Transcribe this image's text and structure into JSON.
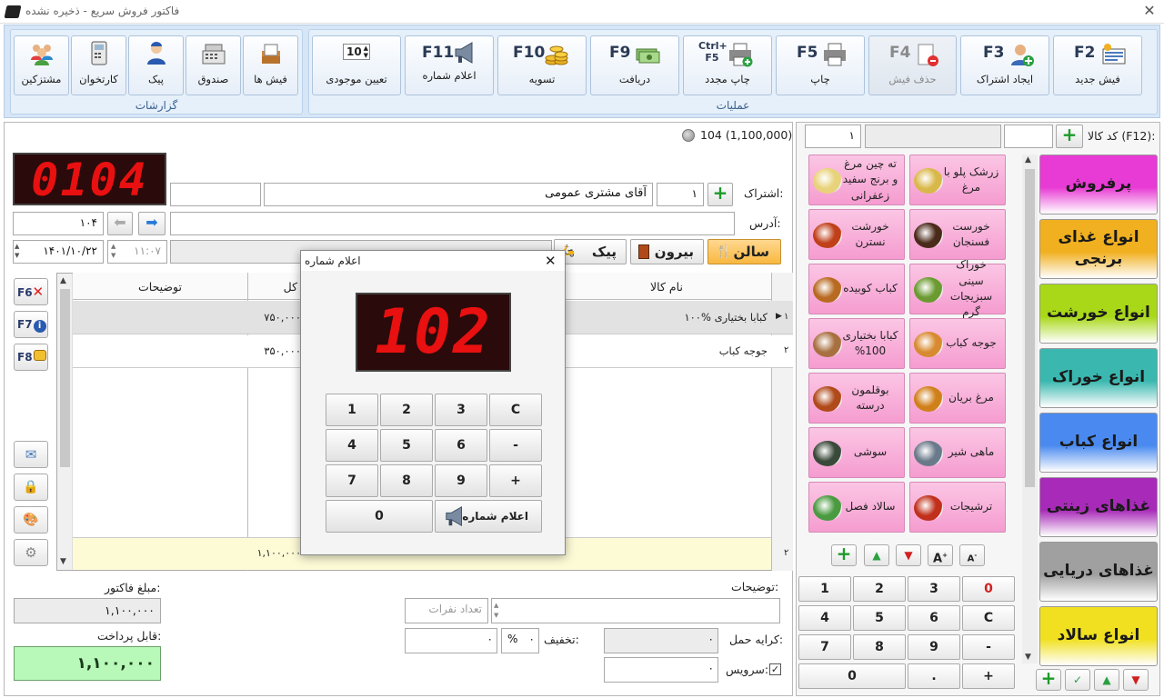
{
  "window": {
    "title": "فاکتور فروش سریع - ذخیره نشده"
  },
  "ribbon": {
    "groups": {
      "operations": "عملیات",
      "reports": "گزارشات"
    },
    "operations": [
      {
        "key": "F2",
        "label": "فیش جدید",
        "icon": "new-invoice-icon"
      },
      {
        "key": "F3",
        "label": "ایجاد اشتراک",
        "icon": "add-subscription-icon"
      },
      {
        "key": "F4",
        "label": "حذف فیش",
        "icon": "delete-invoice-icon",
        "disabled": true
      },
      {
        "key": "F5",
        "label": "چاپ",
        "icon": "printer-icon"
      },
      {
        "key": "Ctrl+ F5",
        "label": "چاپ مجدد",
        "icon": "reprint-icon"
      },
      {
        "key": "F9",
        "label": "دریافت",
        "icon": "cash-icon"
      },
      {
        "key": "F10",
        "label": "تسویه",
        "icon": "coins-icon"
      },
      {
        "key": "F11",
        "label": "اعلام شماره",
        "icon": "megaphone-icon"
      },
      {
        "key": "10",
        "label": "تعیین موجودی",
        "icon": "stepper-icon"
      }
    ],
    "reports": [
      {
        "label": "فیش ها",
        "icon": "receipts-icon"
      },
      {
        "label": "صندوق",
        "icon": "cash-register-icon"
      },
      {
        "label": "پیک",
        "icon": "courier-icon"
      },
      {
        "label": "کارتخوان",
        "icon": "card-reader-icon"
      },
      {
        "label": "مشتزکین",
        "icon": "customers-icon"
      }
    ]
  },
  "invoice": {
    "header_info": "104 (1,100,000)",
    "display_number": "0104",
    "subscription_label": "اشتراک:",
    "subscription_code": "۱",
    "customer_name": "آقای مشتری عمومی",
    "address_label": "آدرس:",
    "invoice_no": "۱۰۴",
    "time": "۱۱:۰۷",
    "date": "۱۴۰۱/۱۰/۲۲",
    "service_types": [
      "سالن",
      "بیرون",
      "پیک"
    ]
  },
  "grid": {
    "headers": {
      "row": "",
      "name": "نام کالا",
      "total": "مبلغ کل",
      "desc": "توضیحات"
    },
    "rows": [
      {
        "idx": "۱",
        "name": "کبابا بختیاری %۱۰۰",
        "total": "۷۵۰,۰۰۰"
      },
      {
        "idx": "۲",
        "name": "جوجه کباب",
        "total": "۳۵۰,۰۰۰"
      }
    ],
    "footer": {
      "idx": "۲",
      "total": "۱,۱۰۰,۰۰۰"
    }
  },
  "side_buttons": [
    "F6",
    "F7",
    "F8"
  ],
  "footer": {
    "desc_label": "توضیحات:",
    "people_placeholder": "تعداد نفرات",
    "shipping_label": "کرایه حمل:",
    "shipping_value": "۰",
    "discount_label": "تخفیف:",
    "discount_percent": "۰",
    "percent_sign": "%",
    "discount_value": "۰",
    "service_label": "سرویس:",
    "service_value": "۰",
    "amount_label": "مبلغ فاکتور:",
    "amount_value": "۱,۱۰۰,۰۰۰",
    "payable_label": "قابل پرداخت:",
    "payable_value": "۱,۱۰۰,۰۰۰"
  },
  "product_search": {
    "label": "کد کالا (F12):",
    "qty": "۱"
  },
  "foods": [
    {
      "label": "زرشک پلو با مرغ",
      "color": "#d9b84a"
    },
    {
      "label": "ته چین مرغ و برنج سفید زعفرانی",
      "color": "#e8d27a"
    },
    {
      "label": "خورست فسنجان",
      "color": "#4a2a1a"
    },
    {
      "label": "خورشت نسترن",
      "color": "#c0401a"
    },
    {
      "label": "خوراک سینی سبزیجات گرم",
      "color": "#6a9a30"
    },
    {
      "label": "کباب کوبیده",
      "color": "#b86a20"
    },
    {
      "label": "جوجه کباب",
      "color": "#d88a30"
    },
    {
      "label": "کبابا بختیاری 100%",
      "color": "#a87040"
    },
    {
      "label": "مرغ بریان",
      "color": "#d0801a"
    },
    {
      "label": "بوقلمون درسته",
      "color": "#b04a1a"
    },
    {
      "label": "ماهی شیر",
      "color": "#6a7a8a"
    },
    {
      "label": "سوشی",
      "color": "#3a4a3a"
    },
    {
      "label": "ترشیجات",
      "color": "#c0301a"
    },
    {
      "label": "سالاد فصل",
      "color": "#4a9a40"
    }
  ],
  "categories": [
    {
      "label": "پرفروش",
      "color": "#e83ad4"
    },
    {
      "label": "انواع غذای برنجی",
      "color": "#f0b020"
    },
    {
      "label": "انواع خورشت",
      "color": "#a8d818"
    },
    {
      "label": "انواع خوراک",
      "color": "#3ab8b0"
    },
    {
      "label": "انواع کباب",
      "color": "#4a8af0"
    },
    {
      "label": "غذاهای زینتی",
      "color": "#a82ab8"
    },
    {
      "label": "غذاهای دریایی",
      "color": "#a0a0a0"
    },
    {
      "label": "انواع سالاد",
      "color": "#f0e020"
    }
  ],
  "keypad": {
    "keys": [
      "0",
      "3",
      "2",
      "1",
      "C",
      "6",
      "5",
      "4",
      "-",
      "9",
      "8",
      "7",
      "+",
      ".",
      "0"
    ]
  },
  "dialog": {
    "title": "اعلام شماره",
    "number": "102",
    "keys": [
      "C",
      "3",
      "2",
      "1",
      "-",
      "6",
      "5",
      "4",
      "+",
      "9",
      "8",
      "7"
    ],
    "announce": "اعلام شماره",
    "zero": "0"
  }
}
